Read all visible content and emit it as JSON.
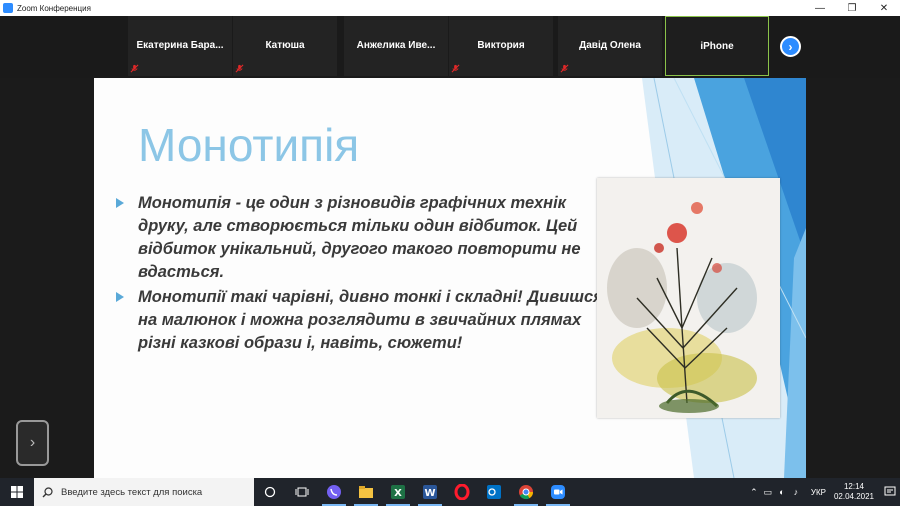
{
  "window": {
    "title": "Zoom Конференция"
  },
  "participants": [
    {
      "name": "Екатерина  Бара...",
      "muted": true
    },
    {
      "name": "Катюша",
      "muted": true
    },
    {
      "name": "Анжелика  Иве...",
      "muted": true
    },
    {
      "name": "Виктория",
      "muted": true
    },
    {
      "name": "Давід Олена",
      "muted": true
    },
    {
      "name": "iPhone",
      "muted": false,
      "active_speaker": true
    }
  ],
  "slide": {
    "title": "Монотипія",
    "bullets": [
      "Монотипія - це один з різновидів графічних технік друку, але створюється тільки один відбиток. Цей відбиток унікальний, другого такого повторити не вдасться.",
      " Монотипії такі чарівні, дивно тонкі і складні! Дивишся на малюнок і  можна розглядити в звичайних плямах різні казкові образи і, навіть, сюжети!"
    ]
  },
  "taskbar": {
    "search_placeholder": "Введите здесь текст для поиска",
    "apps": [
      "task-view-icon",
      "viber-icon",
      "file-explorer-icon",
      "excel-icon",
      "word-icon",
      "opera-icon",
      "outlook-icon",
      "chrome-icon",
      "zoom-icon"
    ],
    "language": "УКР",
    "time": "12:14",
    "date": "02.04.2021"
  },
  "colors": {
    "zoom_blue": "#2d8cff",
    "active_border": "#8bc34a",
    "title_blue": "#8cc6e6"
  }
}
